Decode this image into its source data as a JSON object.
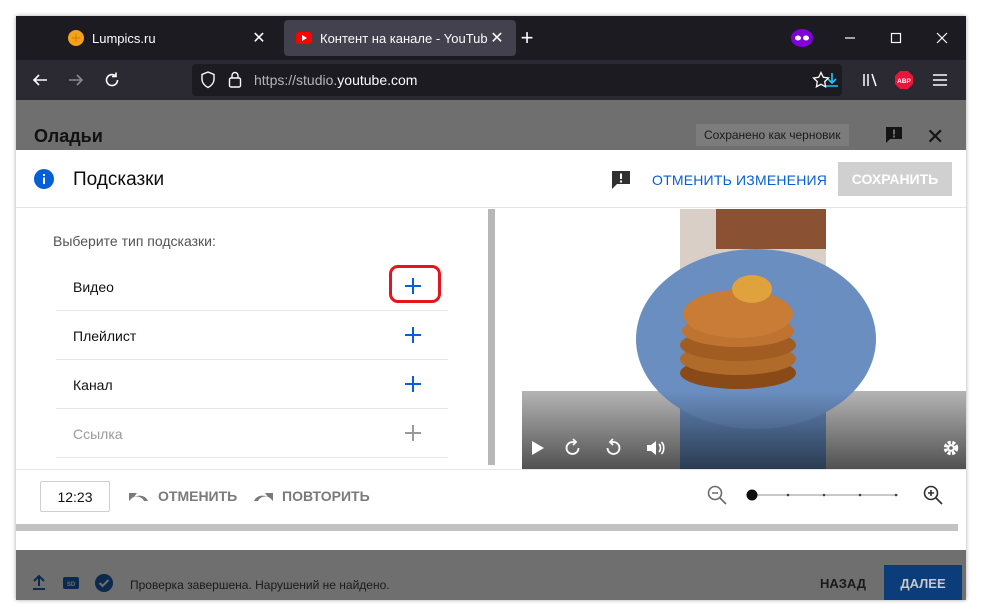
{
  "browser": {
    "tabs": [
      {
        "title": "Lumpics.ru"
      },
      {
        "title": "Контент на канале - YouTube Studio"
      }
    ],
    "url_prefix": "https://studio.",
    "url_domain": "youtube.com"
  },
  "background": {
    "video_title": "Оладьи",
    "draft_badge": "Сохранено как черновик",
    "status": "Проверка завершена. Нарушений не найдено.",
    "back_label": "НАЗАД",
    "next_label": "ДАЛЕЕ"
  },
  "modal": {
    "title": "Подсказки",
    "discard_label": "ОТМЕНИТЬ ИЗМЕНЕНИЯ",
    "save_label": "СОХРАНИТЬ",
    "choose_label": "Выберите тип подсказки:",
    "card_types": [
      {
        "label": "Видео"
      },
      {
        "label": "Плейлист"
      },
      {
        "label": "Канал"
      },
      {
        "label": "Ссылка"
      }
    ],
    "time_value": "12:23",
    "undo_label": "ОТМЕНИТЬ",
    "redo_label": "ПОВТОРИТЬ"
  },
  "colors": {
    "accent": "#065fd4",
    "highlight": "#e4161b",
    "save_disabled": "#d0d0d0"
  }
}
